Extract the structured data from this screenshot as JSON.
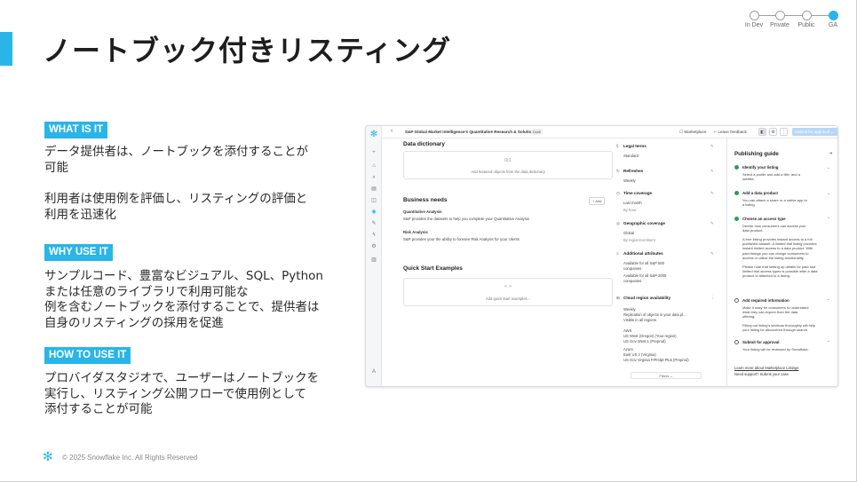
{
  "slide": {
    "title": "ノートブック付きリスティング",
    "stages": [
      {
        "label": "In Dev",
        "active": false
      },
      {
        "label": "Private",
        "active": false
      },
      {
        "label": "Public",
        "active": false
      },
      {
        "label": "GA",
        "active": true
      }
    ],
    "accent_color": "#29b5e8",
    "sections": [
      {
        "badge": "WHAT IS IT",
        "paragraphs": [
          "データ提供者は、ノートブックを添付することが\n可能",
          "利用者は使用例を評価し、リスティングの評価と\n利用を迅速化"
        ]
      },
      {
        "badge": "WHY USE IT",
        "paragraphs": [
          "サンプルコード、豊富なビジュアル、SQL、Python\nまたは任意のライブラリで利用可能な\n例を含むノートブックを添付することで、提供者は\n自身のリスティングの採用を促進"
        ]
      },
      {
        "badge": "HOW TO USE IT",
        "paragraphs": [
          "プロバイダスタジオで、ユーザーはノートブックを\n実行し、リスティング公開フローで使用例として\n添付することが可能"
        ]
      }
    ],
    "footer": {
      "copyright": "© 2025 Snowflake Inc. All Rights Reserved",
      "logo_icon": "snowflake-logo-icon"
    }
  },
  "screenshot": {
    "topbar": {
      "title": "S&P Global Market Intelligence's Quantitative Research & Solutions",
      "draft": "Draft",
      "marketplace": "Marketplace",
      "feedback": "Leave feedback",
      "submit": "Submit for approval"
    },
    "main": {
      "data_dictionary": {
        "heading": "Data dictionary",
        "empty_icon": "0|1",
        "empty_text": "Add featured objects from the data dictionary"
      },
      "business_needs": {
        "heading": "Business needs",
        "add": "+ Add",
        "items": [
          {
            "title": "Quantitative Analysis",
            "desc": "S&P provides the datasets to help you complete your Quantitative Analysis"
          },
          {
            "title": "Risk Analysis",
            "desc": "S&P provides your the ability to foresee Risk Analysis for your clients"
          }
        ]
      },
      "quick_start": {
        "heading": "Quick Start Examples",
        "empty_icon": "< >",
        "empty_text": "Add quick start examples..."
      }
    },
    "attributes": [
      {
        "icon": "§",
        "title": "Legal terms",
        "values": [
          "Standard"
        ]
      },
      {
        "icon": "↻",
        "title": "Refreshes",
        "values": [
          "Weekly"
        ]
      },
      {
        "icon": "◷",
        "title": "Time coverage",
        "values": [
          "Last month",
          "By hour"
        ]
      },
      {
        "icon": "◎",
        "title": "Geographic coverage",
        "values": [
          "Global",
          "By region/continent"
        ]
      },
      {
        "icon": "≡",
        "title": "Additional attributes",
        "values": [
          "Available for all S&P 500",
          "companies",
          "Available for all S&P 2000",
          "companies"
        ]
      },
      {
        "icon": "⊞",
        "title": "Cloud region availability",
        "values": [
          "Weekly",
          "Replication of objects in your data pl...",
          "Visible in all regions",
          "",
          "AWS",
          "US West (Oregon) (Your region)",
          "US Gov West 1 (Preprod)",
          "Azure",
          "East US 2 (Virginia)",
          "US Gov Virginia FIPmlpt-Plus (Preprod)"
        ]
      }
    ],
    "filters": "Filters ⌄",
    "guide": {
      "heading": "Publishing guide",
      "steps": [
        {
          "title": "Identify your listing",
          "done": true,
          "desc": "Select a profile and add a title, and a\nsubtitle."
        },
        {
          "title": "Add a data product",
          "done": true,
          "desc": "You can attach a share or a native app to\na listing."
        },
        {
          "title": "Choose an access type",
          "done": true,
          "desc": "Decide how consumers can access your\ndata product.\n\nA free listing provides instant access to a full\npublished dataset. A limited trial listing provides\ninstant limited access to a data product. With\npaid listings you can charge consumers to\naccess or utilize the listing functionality.\n\nPlease note that setting up details for paid and\nlimited trial access types is possible after a data\nproduct is attached to a listing."
        },
        {
          "title": "Add required information",
          "done": false,
          "desc": "Make it easy for consumers to understand\nwhat they can expect from the data\noffering.\n\nFilling out listing's sections thoroughly will help\nyour listing be discovered through search."
        },
        {
          "title": "Submit for approval",
          "done": false,
          "desc": "Your listing will be reviewed by Snowflake."
        }
      ],
      "learn_more": "Learn more about Marketplace Listings",
      "support": "Need support? Submit your case"
    }
  }
}
